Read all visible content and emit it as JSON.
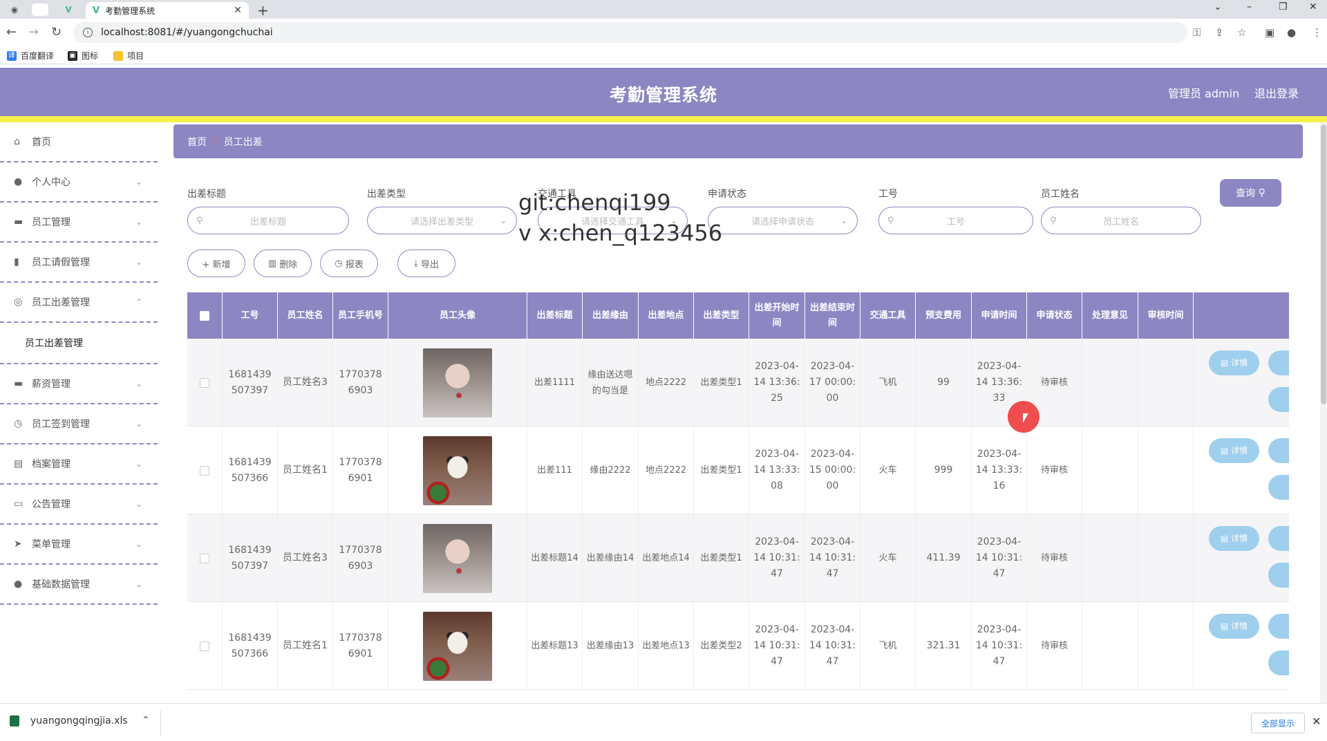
{
  "browser": {
    "tab_title": "考勤管理系统",
    "url": "localhost:8081/#/yuangongchuchai",
    "bookmarks": [
      "百度翻译",
      "图标",
      "项目"
    ],
    "download_file": "yuangongqingjia.xls",
    "show_all": "全部显示"
  },
  "header": {
    "title": "考勤管理系统",
    "user": "管理员 admin",
    "logout": "退出登录"
  },
  "sidebar": {
    "items": [
      {
        "label": "首页",
        "icon": "home-icon"
      },
      {
        "label": "个人中心",
        "icon": "user-icon"
      },
      {
        "label": "员工管理",
        "icon": "briefcase-icon"
      },
      {
        "label": "员工请假管理",
        "icon": "bar-chart-icon"
      },
      {
        "label": "员工出差管理",
        "icon": "settings-icon"
      },
      {
        "label": "薪资管理",
        "icon": "money-icon"
      },
      {
        "label": "员工签到管理",
        "icon": "clock-icon"
      },
      {
        "label": "档案管理",
        "icon": "file-icon"
      },
      {
        "label": "公告管理",
        "icon": "monitor-icon"
      },
      {
        "label": "菜单管理",
        "icon": "send-icon"
      },
      {
        "label": "基础数据管理",
        "icon": "user-icon"
      }
    ],
    "sub_item": "员工出差管理"
  },
  "breadcrumb": {
    "home": "首页",
    "sep": "/",
    "current": "员工出差"
  },
  "filters": {
    "title_label": "出差标题",
    "title_placeholder": "出差标题",
    "type_label": "出差类型",
    "type_placeholder": "请选择出差类型",
    "transport_label": "交通工具",
    "transport_placeholder": "请选择交通工具",
    "status_label": "申请状态",
    "status_placeholder": "请选择申请状态",
    "id_label": "工号",
    "id_placeholder": "工号",
    "name_label": "员工姓名",
    "name_placeholder": "员工姓名",
    "query": "查询"
  },
  "actions": {
    "add": "+ 新增",
    "delete": "删除",
    "report": "报表",
    "export": "导出"
  },
  "watermark": {
    "line1": "git:chenqi199",
    "line2": "v x:chen_q123456"
  },
  "table": {
    "headers": [
      "工号",
      "员工姓名",
      "员工手机号",
      "员工头像",
      "出差标题",
      "出差缘由",
      "出差地点",
      "出差类型",
      "出差开始时间",
      "出差结束时间",
      "交通工具",
      "预支费用",
      "申请时间",
      "申请状态",
      "处理意见",
      "审核时间"
    ],
    "rows": [
      {
        "id": "1681439507397",
        "name": "员工姓名3",
        "phone": "17703786903",
        "avatar": "girl",
        "title": "出差1111",
        "reason": "缘由送达嗯的勾当是",
        "place": "地点2222",
        "type": "出差类型1",
        "start": "2023-04-14 13:36:25",
        "end": "2023-04-17 00:00:00",
        "transport": "飞机",
        "cost": "99",
        "apply": "2023-04-14 13:36:33",
        "status": "待审核",
        "opinion": "",
        "review": ""
      },
      {
        "id": "1681439507366",
        "name": "员工姓名1",
        "phone": "17703786901",
        "avatar": "cat",
        "title": "出差111",
        "reason": "缘由2222",
        "place": "地点2222",
        "type": "出差类型1",
        "start": "2023-04-14 13:33:08",
        "end": "2023-04-15 00:00:00",
        "transport": "火车",
        "cost": "999",
        "apply": "2023-04-14 13:33:16",
        "status": "待审核",
        "opinion": "",
        "review": ""
      },
      {
        "id": "1681439507397",
        "name": "员工姓名3",
        "phone": "17703786903",
        "avatar": "girl",
        "title": "出差标题14",
        "reason": "出差缘由14",
        "place": "出差地点14",
        "type": "出差类型1",
        "start": "2023-04-14 10:31:47",
        "end": "2023-04-14 10:31:47",
        "transport": "火车",
        "cost": "411.39",
        "apply": "2023-04-14 10:31:47",
        "status": "待审核",
        "opinion": "",
        "review": ""
      },
      {
        "id": "1681439507366",
        "name": "员工姓名1",
        "phone": "17703786901",
        "avatar": "cat",
        "title": "出差标题13",
        "reason": "出差缘由13",
        "place": "出差地点13",
        "type": "出差类型2",
        "start": "2023-04-14 10:31:47",
        "end": "2023-04-14 10:31:47",
        "transport": "飞机",
        "cost": "321.31",
        "apply": "2023-04-14 10:31:47",
        "status": "待审核",
        "opinion": "",
        "review": ""
      }
    ],
    "detail_btn": "详情"
  }
}
